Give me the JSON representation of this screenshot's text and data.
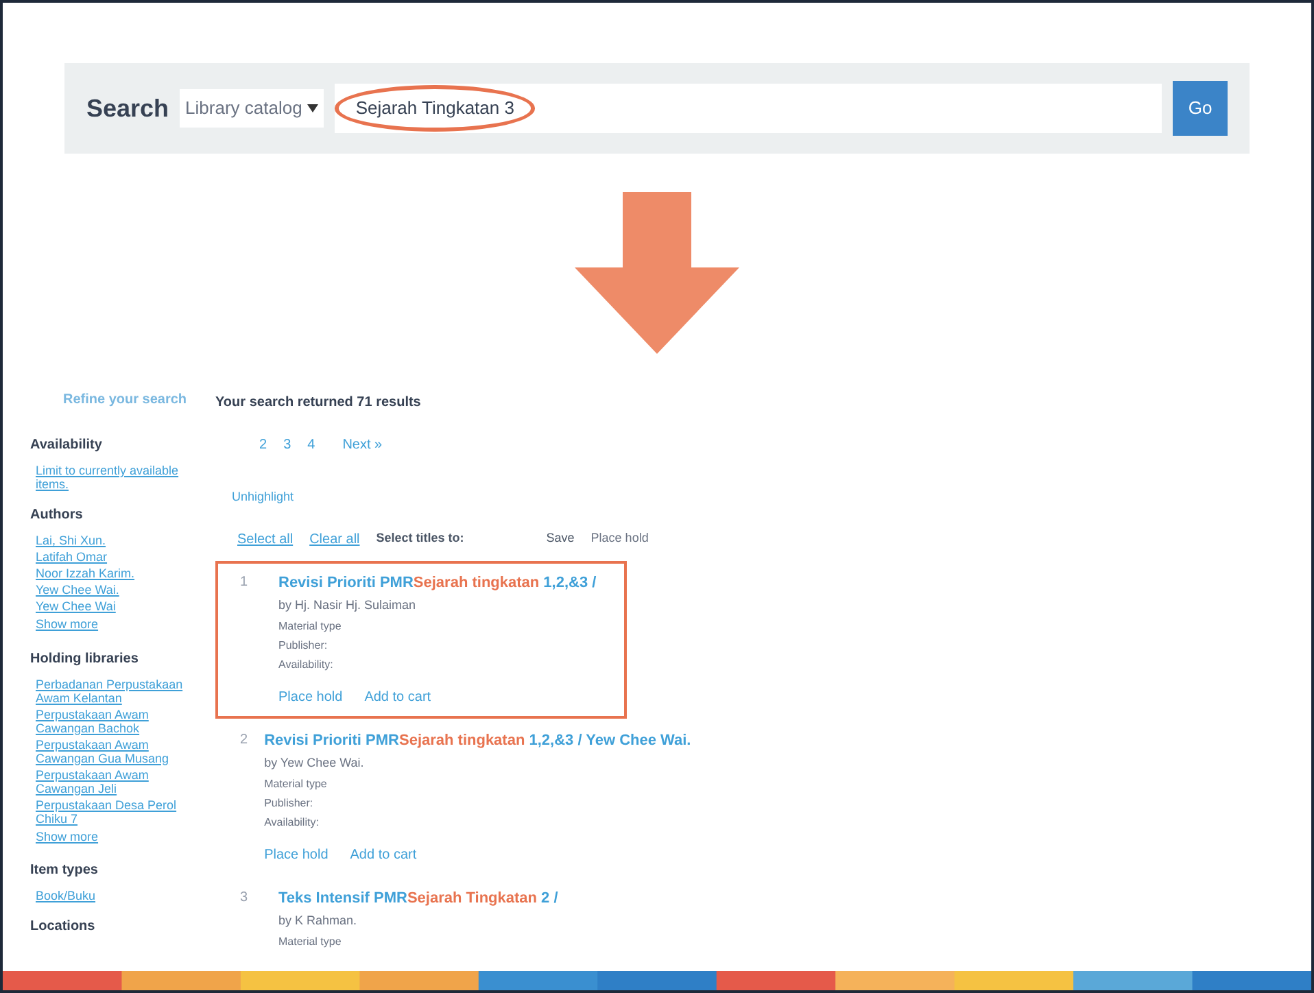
{
  "search_bar": {
    "label": "Search",
    "scope": "Library catalog",
    "query": "Sejarah Tingkatan 3",
    "button": "Go"
  },
  "sidebar": {
    "title": "Refine your search",
    "sections": [
      {
        "heading": "Availability",
        "links": [
          "Limit to currently available items."
        ]
      },
      {
        "heading": "Authors",
        "links": [
          "Lai, Shi Xun.",
          "Latifah Omar",
          "Noor Izzah Karim.",
          "Yew Chee Wai.",
          "Yew Chee Wai"
        ],
        "more": "Show more"
      },
      {
        "heading": "Holding libraries",
        "links": [
          "Perbadanan Perpustakaan Awam Kelantan",
          "Perpustakaan Awam Cawangan Bachok",
          "Perpustakaan Awam Cawangan Gua Musang",
          "Perpustakaan Awam Cawangan Jeli",
          "Perpustakaan Desa Perol Chiku 7"
        ],
        "more": "Show more"
      },
      {
        "heading": "Item types",
        "links": [
          "Book/Buku"
        ]
      },
      {
        "heading": "Locations"
      }
    ]
  },
  "results_summary": "Your search returned 71 results",
  "pages": [
    {
      "label": "2",
      "kind": "page"
    },
    {
      "label": "3",
      "kind": "page"
    },
    {
      "label": "4",
      "kind": "page"
    },
    {
      "label": "Next »",
      "kind": "next"
    }
  ],
  "unhighlight": "Unhighlight",
  "toolbar": {
    "select_all": "Select all",
    "clear_all": "Clear all",
    "select_titles": "Select titles to:",
    "save": "Save",
    "place_hold": "Place hold"
  },
  "results": [
    {
      "number": "1",
      "title": "Revisi Prioriti PMR",
      "match": "Sejarah tingkatan",
      "rest": " 1,2,&3 /",
      "author": "by Hj. Nasir Hj. Sulaiman",
      "lines": [
        "Material type",
        "Publisher:",
        "Availability:"
      ],
      "actions": [
        "Place hold",
        "Add to cart"
      ],
      "circled": true
    },
    {
      "number": "2",
      "title": "Revisi Prioriti PMR",
      "match": "Sejarah tingkatan",
      "rest": " 1,2,&3 / Yew Chee Wai.",
      "author": "by Yew Chee Wai.",
      "lines": [
        "Material type",
        "Publisher:",
        "Availability:"
      ],
      "actions": [
        "Place hold",
        "Add to cart"
      ],
      "circled": false
    },
    {
      "number": "3",
      "title": "Teks Intensif PMR",
      "match": "Sejarah Tingkatan",
      "rest": " 2 /",
      "author": "by K Rahman.",
      "lines": [
        "Material type"
      ],
      "circled": false
    }
  ]
}
